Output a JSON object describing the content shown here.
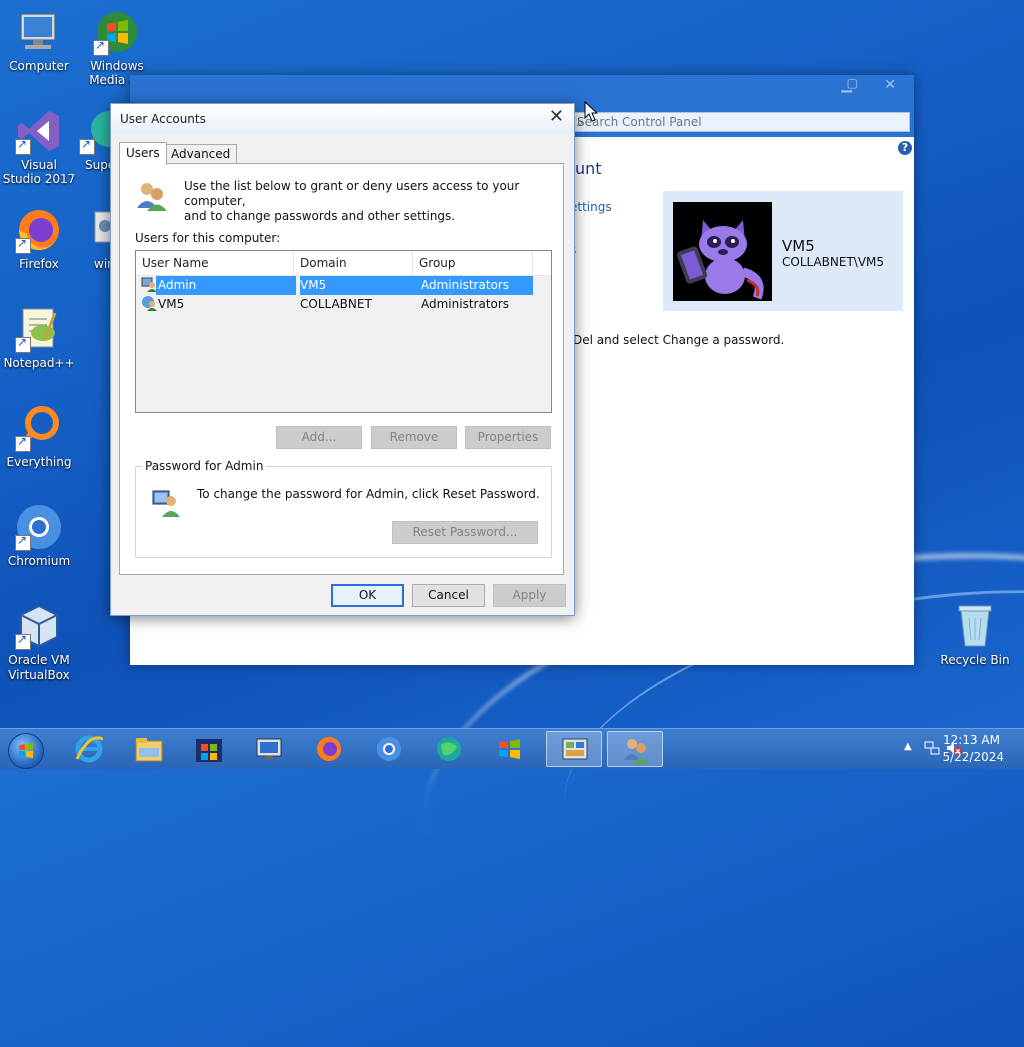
{
  "desktop": {
    "icons": [
      {
        "label": "Computer",
        "icon": "computer-icon"
      },
      {
        "label": "Windows Media Ce",
        "icon": "windows-media-center-icon"
      },
      {
        "label": "Visual Studio 2017",
        "icon": "visual-studio-icon"
      },
      {
        "label": "Supe",
        "icon": "app-shortcut-icon"
      },
      {
        "label": "Firefox",
        "icon": "firefox-icon"
      },
      {
        "label": "win",
        "icon": "app-shortcut-icon"
      },
      {
        "label": "Notepad++",
        "icon": "notepad-plus-plus-icon"
      },
      {
        "label": "Everything",
        "icon": "everything-search-icon"
      },
      {
        "label": "Chromium",
        "icon": "chromium-icon"
      },
      {
        "label": "Oracle VM VirtualBox",
        "icon": "virtualbox-icon"
      },
      {
        "label": "Recycle Bin",
        "icon": "recycle-bin-icon"
      }
    ]
  },
  "control_panel": {
    "search_placeholder": "Search Control Panel",
    "heading_fragment": "unt",
    "link_settings_fragment": "ettings",
    "link_s_fragment": "s",
    "user_name": "VM5",
    "user_domain": "COLLABNET\\VM5",
    "note_fragment": "Del and select Change a password."
  },
  "dialog": {
    "title": "User Accounts",
    "close_glyph": "✕",
    "tabs": [
      {
        "label": "Users",
        "active": true
      },
      {
        "label": "Advanced",
        "active": false
      }
    ],
    "intro_line1": "Use the list below to grant or deny users access to your computer,",
    "intro_line2": "and to change passwords and other settings.",
    "users_label": "Users for this computer:",
    "columns": [
      "User Name",
      "Domain",
      "Group"
    ],
    "rows": [
      {
        "user": "Admin",
        "domain": "VM5",
        "group": "Administrators",
        "selected": true
      },
      {
        "user": "VM5",
        "domain": "COLLABNET",
        "group": "Administrators",
        "selected": false
      }
    ],
    "buttons": {
      "add": "Add...",
      "remove": "Remove",
      "properties": "Properties",
      "reset_password": "Reset Password...",
      "ok": "OK",
      "cancel": "Cancel",
      "apply": "Apply"
    },
    "password_group_title": "Password for Admin",
    "password_text": "To change the password for Admin, click Reset Password."
  },
  "taskbar": {
    "items": [
      {
        "icon": "internet-explorer-icon"
      },
      {
        "icon": "file-explorer-icon"
      },
      {
        "icon": "windows-store-icon"
      },
      {
        "icon": "remote-desktop-icon"
      },
      {
        "icon": "firefox-icon"
      },
      {
        "icon": "chromium-icon"
      },
      {
        "icon": "maps-icon"
      },
      {
        "icon": "windows-media-center-icon"
      },
      {
        "icon": "control-panel-icon",
        "active": true
      },
      {
        "icon": "user-accounts-icon",
        "active": true
      }
    ],
    "clock_time": "12:13 AM",
    "clock_date": "5/22/2024"
  },
  "colors": {
    "selection": "#3399ff",
    "link": "#1f5fb5",
    "taskbar": "#2a65b8",
    "desktop": "#1560c6"
  }
}
